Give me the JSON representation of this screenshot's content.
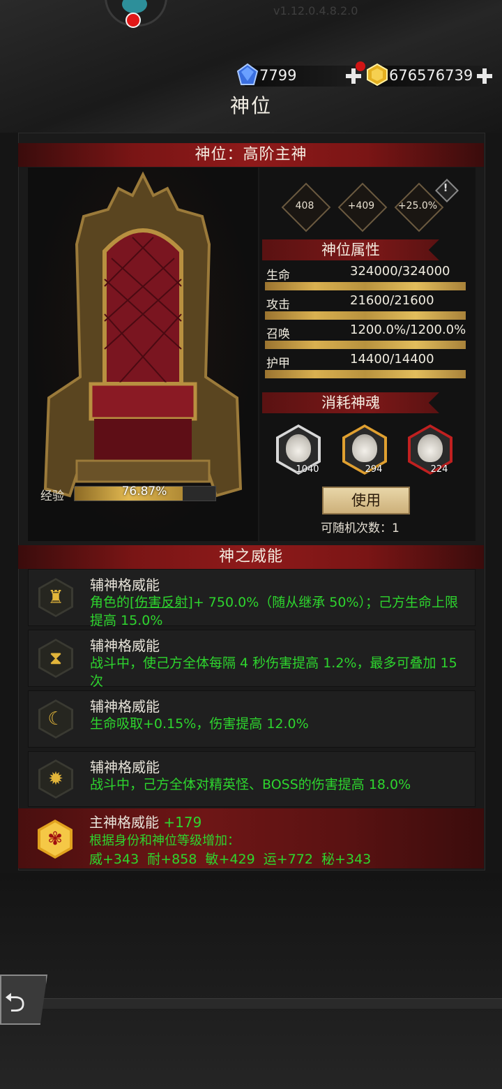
{
  "header": {
    "version": "v1.12.0.4.8.2.0",
    "gem_value": "7799",
    "gold_value": "676576739",
    "title": "神位"
  },
  "throne": {
    "banner": "神位：高阶主神",
    "exp_label": "经验",
    "exp_percent_text": "76.87%",
    "exp_fraction": 0.7687
  },
  "stats_top": {
    "value1": "408",
    "value2": "+409",
    "value3": "+25.0%",
    "warn": "!"
  },
  "attributes": {
    "title": "神位属性",
    "items": [
      {
        "name": "生命",
        "value": "324000/324000"
      },
      {
        "name": "攻击",
        "value": "21600/21600"
      },
      {
        "name": "召唤",
        "value": "1200.0%/1200.0%"
      },
      {
        "name": "护甲",
        "value": "14400/14400"
      }
    ]
  },
  "souls": {
    "title": "消耗神魂",
    "items": [
      {
        "count": "1040",
        "color": "#d8d8d8"
      },
      {
        "count": "294",
        "color": "#e0a030"
      },
      {
        "count": "224",
        "color": "#c02020"
      }
    ],
    "use_label": "使用",
    "random_text": "可随机次数：1"
  },
  "power": {
    "banner": "神之威能",
    "rows": [
      {
        "title": "辅神格威能",
        "desc_pre": "角色的",
        "desc_link": "[伤害反射]",
        "desc_post": "+ 750.0%（随从继承 50%）；己方生命上限提高 15.0%",
        "icon": "castle-icon"
      },
      {
        "title": "辅神格威能",
        "desc": "战斗中，使己方全体每隔 4 秒伤害提高 1.2%，最多可叠加 15 次",
        "icon": "hourglass-icon"
      },
      {
        "title": "辅神格威能",
        "desc": "生命吸取+0.15%，伤害提高 12.0%",
        "icon": "moon-icon"
      },
      {
        "title": "辅神格威能",
        "desc": "战斗中，己方全体对精英怪、BOSS的伤害提高 18.0%",
        "icon": "sun-icon"
      }
    ],
    "main": {
      "title": "主神格威能",
      "bonus": "+179",
      "line1": "根据身份和神位等级增加：",
      "line2": "威+343  耐+858  敏+429  运+772  秘+343",
      "icon": "flower-icon"
    }
  }
}
